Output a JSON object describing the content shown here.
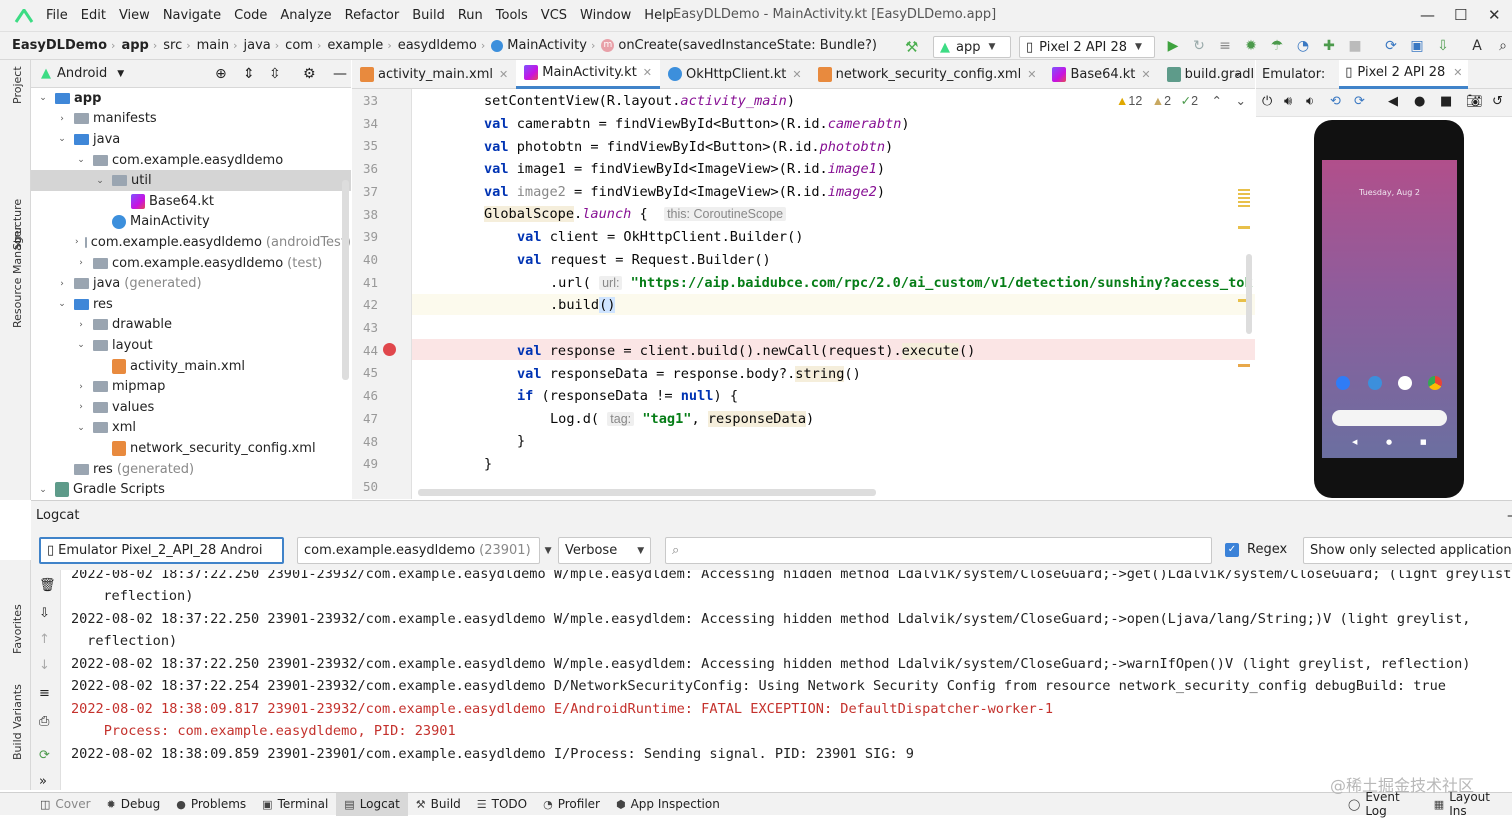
{
  "window": {
    "title": "EasyDLDemo - MainActivity.kt [EasyDLDemo.app]"
  },
  "menu": [
    "File",
    "Edit",
    "View",
    "Navigate",
    "Code",
    "Analyze",
    "Refactor",
    "Build",
    "Run",
    "Tools",
    "VCS",
    "Window",
    "Help"
  ],
  "breadcrumb": [
    "EasyDLDemo",
    "app",
    "src",
    "main",
    "java",
    "com",
    "example",
    "easydldemo",
    "MainActivity",
    "onCreate(savedInstanceState: Bundle?)"
  ],
  "toolbar": {
    "run_config": "app",
    "device": "Pixel 2 API 28"
  },
  "project": {
    "view": "Android",
    "tree": [
      {
        "label": "app",
        "extra": "",
        "depth": 0,
        "arrow": "v",
        "icon": "app"
      },
      {
        "label": "manifests",
        "extra": "",
        "depth": 1,
        "arrow": ">",
        "icon": "folder"
      },
      {
        "label": "java",
        "extra": "",
        "depth": 1,
        "arrow": "v",
        "icon": "folder"
      },
      {
        "label": "com.example.easydldemo",
        "extra": "",
        "depth": 2,
        "arrow": "v",
        "icon": "folder"
      },
      {
        "label": "util",
        "extra": "",
        "depth": 3,
        "arrow": "v",
        "icon": "folder"
      },
      {
        "label": "Base64.kt",
        "extra": "",
        "depth": 4,
        "arrow": "",
        "icon": "kt"
      },
      {
        "label": "MainActivity",
        "extra": "",
        "depth": 3,
        "arrow": "",
        "icon": "class"
      },
      {
        "label": "com.example.easydldemo",
        "extra": "(androidTest)",
        "depth": 2,
        "arrow": ">",
        "icon": "folder"
      },
      {
        "label": "com.example.easydldemo",
        "extra": "(test)",
        "depth": 2,
        "arrow": ">",
        "icon": "folder"
      },
      {
        "label": "java",
        "extra": "(generated)",
        "depth": 1,
        "arrow": ">",
        "icon": "folder"
      },
      {
        "label": "res",
        "extra": "",
        "depth": 1,
        "arrow": "v",
        "icon": "folder"
      },
      {
        "label": "drawable",
        "extra": "",
        "depth": 2,
        "arrow": ">",
        "icon": "folder"
      },
      {
        "label": "layout",
        "extra": "",
        "depth": 2,
        "arrow": "v",
        "icon": "folder"
      },
      {
        "label": "activity_main.xml",
        "extra": "",
        "depth": 3,
        "arrow": "",
        "icon": "xml"
      },
      {
        "label": "mipmap",
        "extra": "",
        "depth": 2,
        "arrow": ">",
        "icon": "folder"
      },
      {
        "label": "values",
        "extra": "",
        "depth": 2,
        "arrow": ">",
        "icon": "folder"
      },
      {
        "label": "xml",
        "extra": "",
        "depth": 2,
        "arrow": "v",
        "icon": "folder"
      },
      {
        "label": "network_security_config.xml",
        "extra": "",
        "depth": 3,
        "arrow": "",
        "icon": "xml"
      },
      {
        "label": "res",
        "extra": "(generated)",
        "depth": 1,
        "arrow": "",
        "icon": "folder"
      },
      {
        "label": "Gradle Scripts",
        "extra": "",
        "depth": 0,
        "arrow": "v",
        "icon": "gradle"
      }
    ]
  },
  "sidebars": {
    "left_top": [
      "Project",
      "Structure",
      "Resource Manager"
    ],
    "left_bottom": [
      "Favorites",
      "Build Variants"
    ]
  },
  "tabs": [
    "activity_main.xml",
    "MainActivity.kt",
    "OkHttpClient.kt",
    "network_security_config.xml",
    "Base64.kt",
    "build.gradl"
  ],
  "inspections": {
    "warn_a": "12",
    "warn_b": "2",
    "ok": "2"
  },
  "editor": {
    "line_numbers": [
      "33",
      "34",
      "35",
      "36",
      "37",
      "38",
      "39",
      "40",
      "41",
      "42",
      "43",
      "44",
      "45",
      "46",
      "47",
      "48",
      "49",
      "50"
    ],
    "hints": {
      "scope": "this: CoroutineScope",
      "url": "url:",
      "tag": "tag:"
    },
    "url": "\"https://aip.baidubce.com/rpc/2.0/ai_custom/v1/detection/sunshiny?access_tok",
    "tag_string": "\"tag1\""
  },
  "emulator": {
    "label": "Emulator:",
    "device_tab": "Pixel 2 API 28",
    "clock": "Tuesday, Aug 2"
  },
  "logcat": {
    "title": "Logcat",
    "device": "Emulator Pixel_2_API_28 Androic",
    "process": "com.example.easydldemo",
    "pid": "(23901)",
    "level": "Verbose",
    "search": "",
    "regex_label": "Regex",
    "filter": "Show only selected application",
    "lines": [
      {
        "text": "2022-08-02 18:37:22.250 23901-23932/com.example.easydldemo W/mple.easydldem: Accessing hidden method Ldalvik/system/CloseGuard;->get()Ldalvik/system/CloseGuard; (light greylist,",
        "err": false
      },
      {
        "text": "  reflection)",
        "err": false
      },
      {
        "text": "2022-08-02 18:37:22.250 23901-23932/com.example.easydldemo W/mple.easydldem: Accessing hidden method Ldalvik/system/CloseGuard;->open(Ljava/lang/String;)V (light greylist,",
        "err": false
      },
      {
        "text": " reflection)",
        "err": false
      },
      {
        "text": "2022-08-02 18:37:22.250 23901-23932/com.example.easydldemo W/mple.easydldem: Accessing hidden method Ldalvik/system/CloseGuard;->warnIfOpen()V (light greylist, reflection)",
        "err": false
      },
      {
        "text": "2022-08-02 18:37:22.254 23901-23932/com.example.easydldemo D/NetworkSecurityConfig: Using Network Security Config from resource network_security_config debugBuild: true",
        "err": false
      },
      {
        "text": "2022-08-02 18:38:09.817 23901-23932/com.example.easydldemo E/AndroidRuntime: FATAL EXCEPTION: DefaultDispatcher-worker-1",
        "err": true
      },
      {
        "text": "    Process: com.example.easydldemo, PID: 23901",
        "err": true
      },
      {
        "text": "2022-08-02 18:38:09.859 23901-23901/com.example.easydldemo I/Process: Sending signal. PID: 23901 SIG: 9",
        "err": false
      }
    ]
  },
  "statusbar": {
    "left": [
      "Cover",
      "Debug",
      "Problems",
      "Terminal",
      "Logcat",
      "Build",
      "TODO",
      "Profiler",
      "App Inspection"
    ],
    "right": [
      "Event Log",
      "Layout Ins"
    ]
  },
  "watermark": "@稀土掘金技术社区"
}
